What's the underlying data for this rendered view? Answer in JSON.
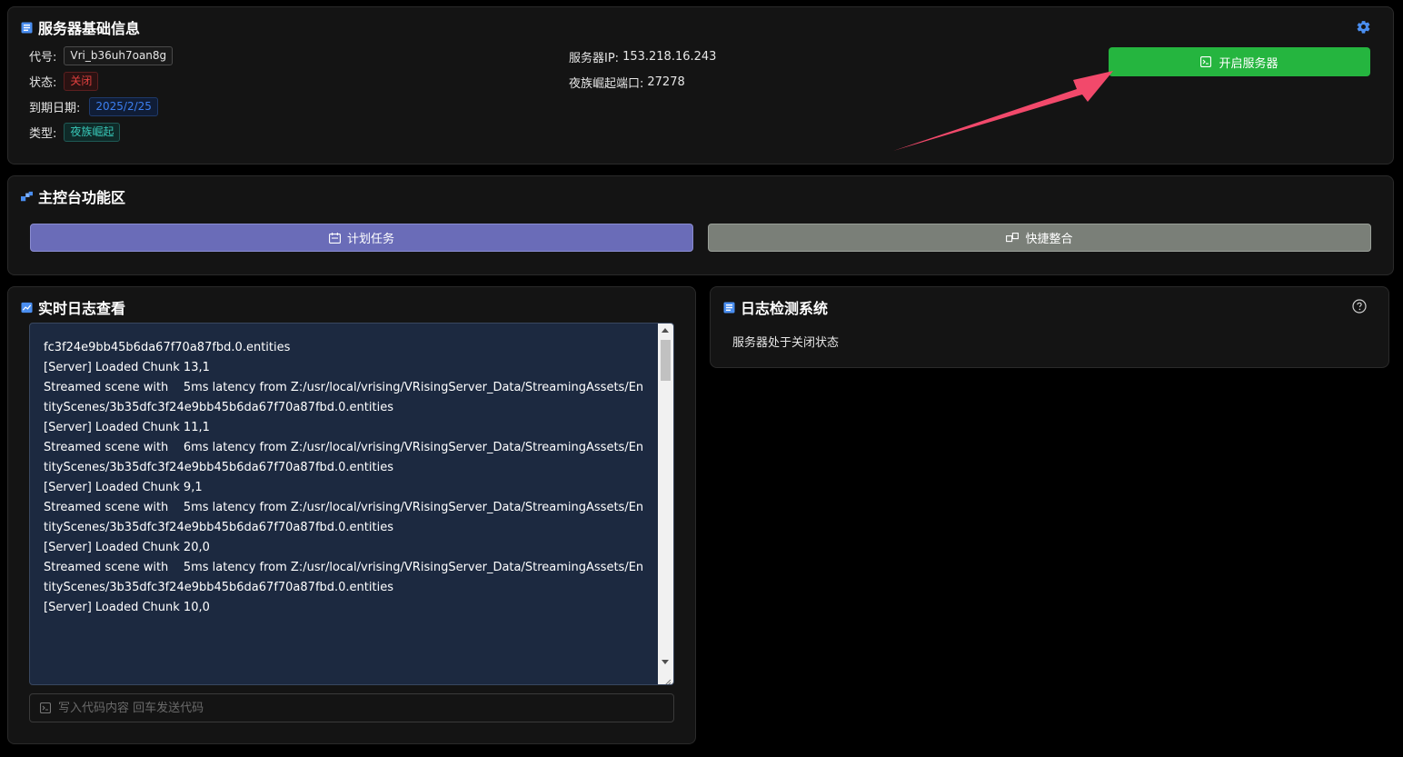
{
  "server_info": {
    "title": "服务器基础信息",
    "code_label": "代号:",
    "code_value": "Vri_b36uh7oan8g",
    "status_label": "状态:",
    "status_value": "关闭",
    "expiry_label": "到期日期:",
    "expiry_value": "2025/2/25",
    "type_label": "类型:",
    "type_value": "夜族崛起",
    "ip_label": "服务器IP:",
    "ip_value": "153.218.16.243",
    "port_label": "夜族崛起端口:",
    "port_value": "27278",
    "start_button": "开启服务器"
  },
  "console": {
    "title": "主控台功能区",
    "schedule_button": "计划任务",
    "quick_button": "快捷整合"
  },
  "log_view": {
    "title": "实时日志查看",
    "lines": [
      "fc3f24e9bb45b6da67f70a87fbd.0.entities",
      "[Server] Loaded Chunk 13,1",
      "Streamed scene with    5ms latency from Z:/usr/local/vrising/VRisingServer_Data/StreamingAssets/EntityScenes/3b35dfc3f24e9bb45b6da67f70a87fbd.0.entities",
      "[Server] Loaded Chunk 11,1",
      "Streamed scene with    6ms latency from Z:/usr/local/vrising/VRisingServer_Data/StreamingAssets/EntityScenes/3b35dfc3f24e9bb45b6da67f70a87fbd.0.entities",
      "[Server] Loaded Chunk 9,1",
      "Streamed scene with    5ms latency from Z:/usr/local/vrising/VRisingServer_Data/StreamingAssets/EntityScenes/3b35dfc3f24e9bb45b6da67f70a87fbd.0.entities",
      "[Server] Loaded Chunk 20,0",
      "Streamed scene with    5ms latency from Z:/usr/local/vrising/VRisingServer_Data/StreamingAssets/EntityScenes/3b35dfc3f24e9bb45b6da67f70a87fbd.0.entities",
      "[Server] Loaded Chunk 10,0"
    ],
    "input_placeholder": "写入代码内容 回车发送代码"
  },
  "detection": {
    "title": "日志检测系统",
    "status_text": "服务器处于关闭状态"
  },
  "colors": {
    "green_button": "#25b53f",
    "purple_button": "#6a6cb8",
    "gray_button": "#7a7f78",
    "arrow": "#f2496b"
  }
}
